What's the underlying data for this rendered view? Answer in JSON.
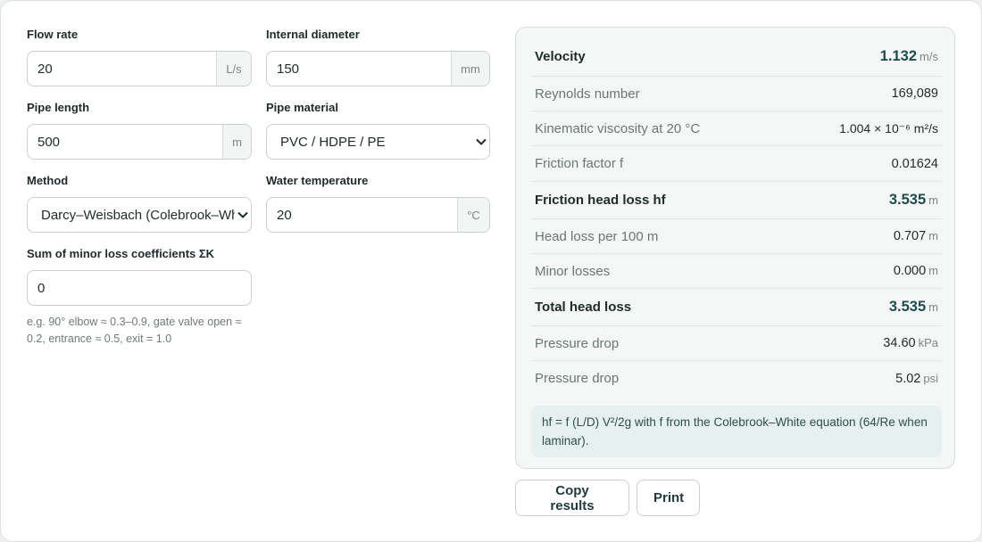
{
  "form": {
    "flow_rate": {
      "label": "Flow rate",
      "value": "20",
      "unit": "L/s"
    },
    "internal_diameter": {
      "label": "Internal diameter",
      "value": "150",
      "unit": "mm"
    },
    "pipe_length": {
      "label": "Pipe length",
      "value": "500",
      "unit": "m"
    },
    "pipe_material": {
      "label": "Pipe material",
      "selected": "PVC / HDPE / PE"
    },
    "method": {
      "label": "Method",
      "selected": "Darcy–Weisbach (Colebrook–White)"
    },
    "water_temperature": {
      "label": "Water temperature",
      "value": "20",
      "unit": "°C"
    },
    "minor_loss": {
      "label": "Sum of minor loss coefficients ΣK",
      "value": "0",
      "hint": "e.g. 90° elbow ≈ 0.3–0.9, gate valve open ≈ 0.2, entrance ≈ 0.5, exit = 1.0"
    }
  },
  "results": {
    "velocity": {
      "label": "Velocity",
      "value": "1.132",
      "unit": "m/s"
    },
    "reynolds": {
      "label": "Reynolds number",
      "value": "169,089"
    },
    "viscosity": {
      "label": "Kinematic viscosity at 20 °C",
      "value": "1.004 × 10⁻⁶ m²/s"
    },
    "friction_factor": {
      "label": "Friction factor f",
      "value": "0.01624"
    },
    "friction_head_loss": {
      "label": "Friction head loss hf",
      "value": "3.535",
      "unit": "m"
    },
    "head_loss_100m": {
      "label": "Head loss per 100 m",
      "value": "0.707",
      "unit": "m"
    },
    "minor_losses": {
      "label": "Minor losses",
      "value": "0.000",
      "unit": "m"
    },
    "total_head_loss": {
      "label": "Total head loss",
      "value": "3.535",
      "unit": "m"
    },
    "pressure_drop_kpa": {
      "label": "Pressure drop",
      "value": "34.60",
      "unit": "kPa"
    },
    "pressure_drop_psi": {
      "label": "Pressure drop",
      "value": "5.02",
      "unit": "psi"
    },
    "note": "hf = f (L/D) V²/2g with f from the Colebrook–White equation (64/Re when laminar)."
  },
  "actions": {
    "copy_label": "Copy results",
    "print_label": "Print"
  }
}
